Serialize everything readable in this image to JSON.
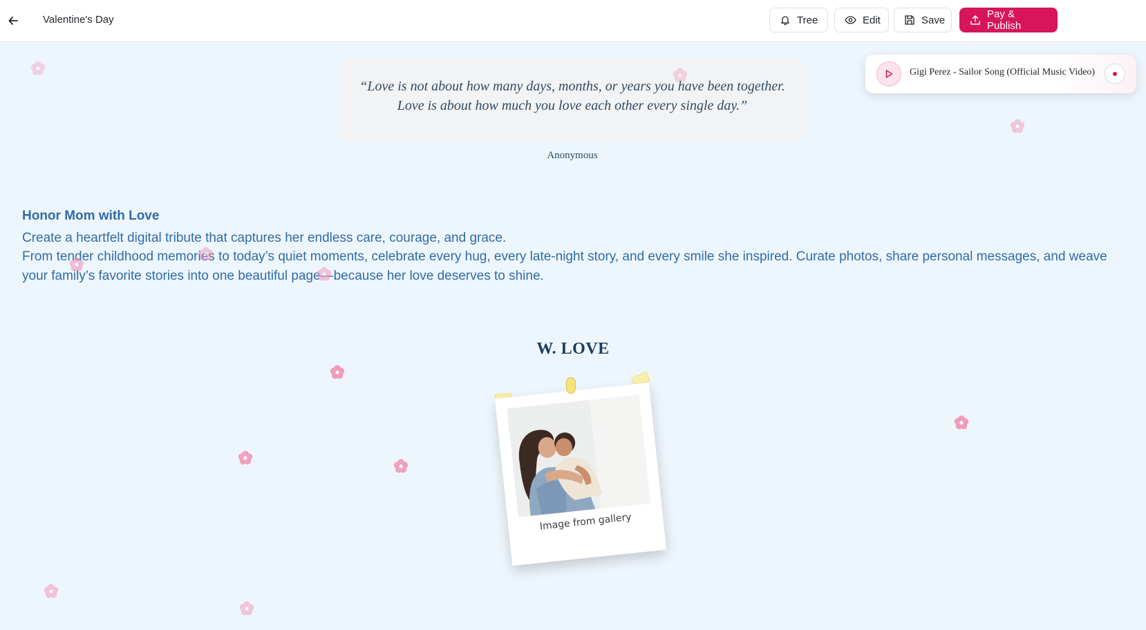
{
  "header": {
    "title": "Valentine's Day",
    "buttons": {
      "tree": "Tree",
      "edit": "Edit",
      "save": "Save",
      "publish": "Pay & Publish"
    }
  },
  "player": {
    "song_title": "Gigi Perez - Sailor Song (Official Music Video)"
  },
  "quote": {
    "line1": "“Love is not about how many days, months, or years you have been together.",
    "line2": "Love is about how much you love each other every single day.”",
    "author": "Anonymous"
  },
  "tribute": {
    "heading": "Honor Mom with Love",
    "line1": "Create a heartfelt digital tribute that captures her endless care, courage, and grace.",
    "line2": "From tender childhood memories to today’s quiet moments, celebrate every hug, every late-night story, and every smile she inspired. Curate photos, share personal messages, and weave your family’s favorite stories into one beautiful page—because her love deserves to shine."
  },
  "gallery": {
    "heading": "W. LOVE",
    "caption": "Image from gallery"
  },
  "colors": {
    "accent": "#d7155a",
    "text_blue": "#2f6ba8",
    "heading_navy": "#1b3d5e",
    "background": "#eef6fd",
    "flower": "#f28db2"
  }
}
